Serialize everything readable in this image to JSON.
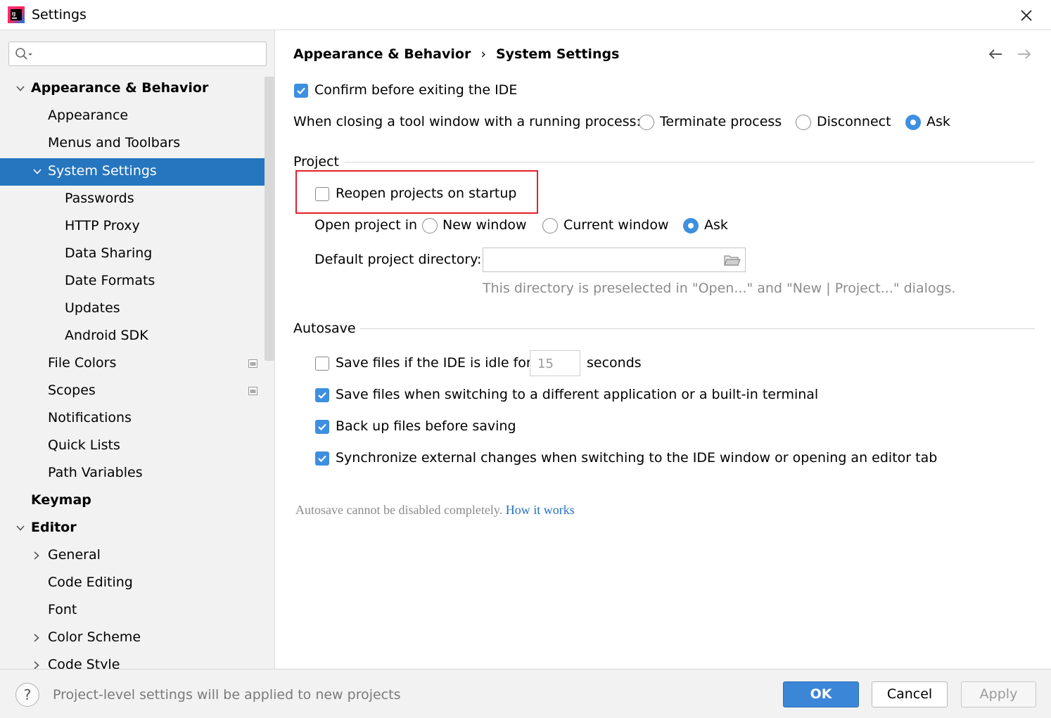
{
  "window": {
    "title": "Settings"
  },
  "sidebar": {
    "search_placeholder": "",
    "items": [
      {
        "label": "Appearance & Behavior"
      },
      {
        "label": "Appearance"
      },
      {
        "label": "Menus and Toolbars"
      },
      {
        "label": "System Settings"
      },
      {
        "label": "Passwords"
      },
      {
        "label": "HTTP Proxy"
      },
      {
        "label": "Data Sharing"
      },
      {
        "label": "Date Formats"
      },
      {
        "label": "Updates"
      },
      {
        "label": "Android SDK"
      },
      {
        "label": "File Colors"
      },
      {
        "label": "Scopes"
      },
      {
        "label": "Notifications"
      },
      {
        "label": "Quick Lists"
      },
      {
        "label": "Path Variables"
      },
      {
        "label": "Keymap"
      },
      {
        "label": "Editor"
      },
      {
        "label": "General"
      },
      {
        "label": "Code Editing"
      },
      {
        "label": "Font"
      },
      {
        "label": "Color Scheme"
      },
      {
        "label": "Code Style"
      }
    ]
  },
  "breadcrumb": {
    "parent": "Appearance & Behavior",
    "separator": "›",
    "current": "System Settings"
  },
  "general": {
    "confirm_exit_label": "Confirm before exiting the IDE",
    "confirm_exit_checked": true,
    "closing_tool_window_label": "When closing a tool window with a running process:",
    "closing_options": [
      "Terminate process",
      "Disconnect",
      "Ask"
    ],
    "closing_selected": "Ask"
  },
  "project": {
    "section_title": "Project",
    "reopen_label": "Reopen projects on startup",
    "reopen_checked": false,
    "open_in_label": "Open project in",
    "open_in_options": [
      "New window",
      "Current window",
      "Ask"
    ],
    "open_in_selected": "Ask",
    "default_dir_label": "Default project directory:",
    "default_dir_value": "",
    "default_dir_hint": "This directory is preselected in \"Open...\" and \"New | Project...\" dialogs."
  },
  "autosave": {
    "section_title": "Autosave",
    "idle_label_before": "Save files if the IDE is idle for",
    "idle_value": "15",
    "idle_label_after": "seconds",
    "idle_checked": false,
    "switch_app_label": "Save files when switching to a different application or a built-in terminal",
    "switch_app_checked": true,
    "backup_label": "Back up files before saving",
    "backup_checked": true,
    "sync_label": "Synchronize external changes when switching to the IDE window or opening an editor tab",
    "sync_checked": true,
    "note": "Autosave cannot be disabled completely.",
    "note_link": "How it works"
  },
  "footer": {
    "help_glyph": "?",
    "message": "Project-level settings will be applied to new projects",
    "ok_label": "OK",
    "cancel_label": "Cancel",
    "apply_label": "Apply"
  },
  "colors": {
    "accent": "#3d8fe0",
    "selection": "#2675bf",
    "highlight_box": "#e2202c",
    "link": "#2470c2"
  }
}
